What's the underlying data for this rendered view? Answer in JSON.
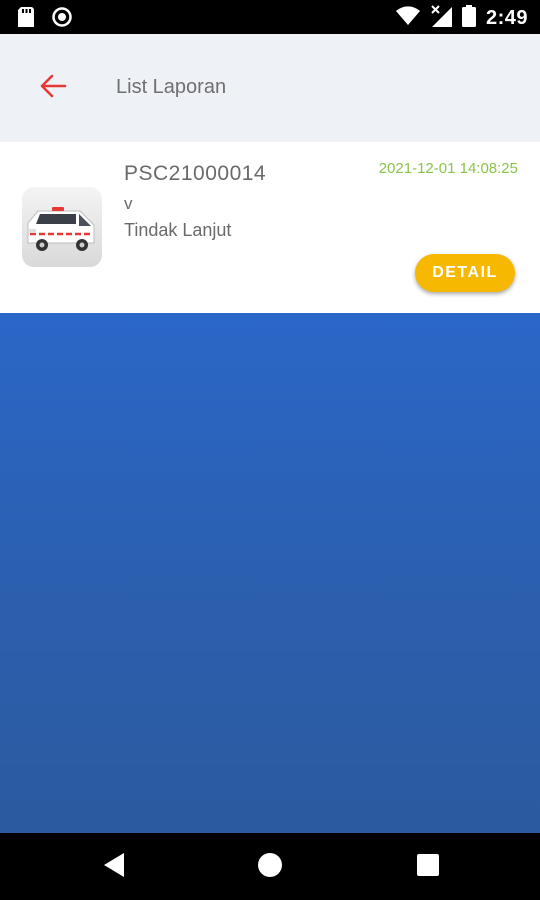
{
  "status_bar": {
    "time": "2:49",
    "icons": [
      "sd-card-icon",
      "sync-icon",
      "wifi-icon",
      "no-signal-icon",
      "battery-icon"
    ]
  },
  "app_bar": {
    "title": "List Laporan",
    "back_icon": "arrow-left-icon",
    "accent_color": "#e53935"
  },
  "reports": [
    {
      "id": "PSC21000014",
      "type": "v",
      "status": "Tindak Lanjut",
      "timestamp": "2021-12-01 14:08:25",
      "image": "ambulance-image",
      "detail_label": "DETAIL"
    }
  ],
  "colors": {
    "app_bar_bg": "#eef1f5",
    "timestamp": "#8bc34a",
    "detail_button": "#f6b800",
    "content_bg": "#2b63bb"
  },
  "nav_bar": {
    "icons": [
      "back-triangle-icon",
      "home-circle-icon",
      "recents-square-icon"
    ]
  }
}
